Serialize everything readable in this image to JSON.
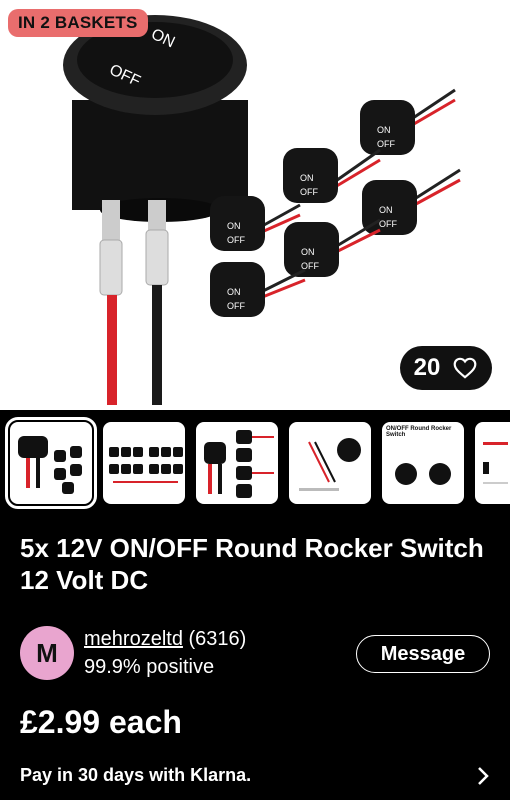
{
  "hero": {
    "badge": "IN 2 BASKETS",
    "watch_count": "20"
  },
  "product": {
    "title": "5x 12V ON/OFF Round Rocker Switch 12 Volt DC",
    "price": "£2.99 each",
    "switch_label_on": "ON",
    "switch_label_off": "OFF",
    "thumb5_caption": "ON/OFF Round Rocker Switch"
  },
  "seller": {
    "initial": "M",
    "name": "mehrozeltd",
    "feedback_count": "(6316)",
    "positive": "99.9% positive",
    "message_label": "Message"
  },
  "payment": {
    "klarna_text": "Pay in 30 days with Klarna."
  },
  "colors": {
    "badge": "#e96d6d",
    "avatar": "#e9a5cf"
  }
}
